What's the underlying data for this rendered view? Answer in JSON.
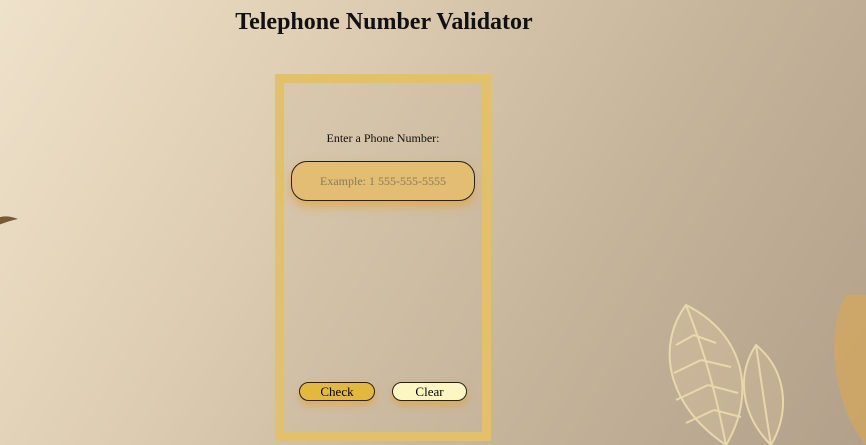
{
  "page": {
    "title": "Telephone Number Validator"
  },
  "form": {
    "label": "Enter a Phone Number:",
    "input_value": "",
    "input_placeholder": "Example: 1 555-555-5555",
    "check_label": "Check",
    "clear_label": "Clear"
  },
  "colors": {
    "frame": "#e3c169",
    "input_bg": "#e2bd72",
    "check_bg": "#e3b93c",
    "clear_bg": "#fcf6c0"
  },
  "decorations": {
    "left_icon": "leaf-icon",
    "right_icon": "leaves-decoration-icon"
  }
}
